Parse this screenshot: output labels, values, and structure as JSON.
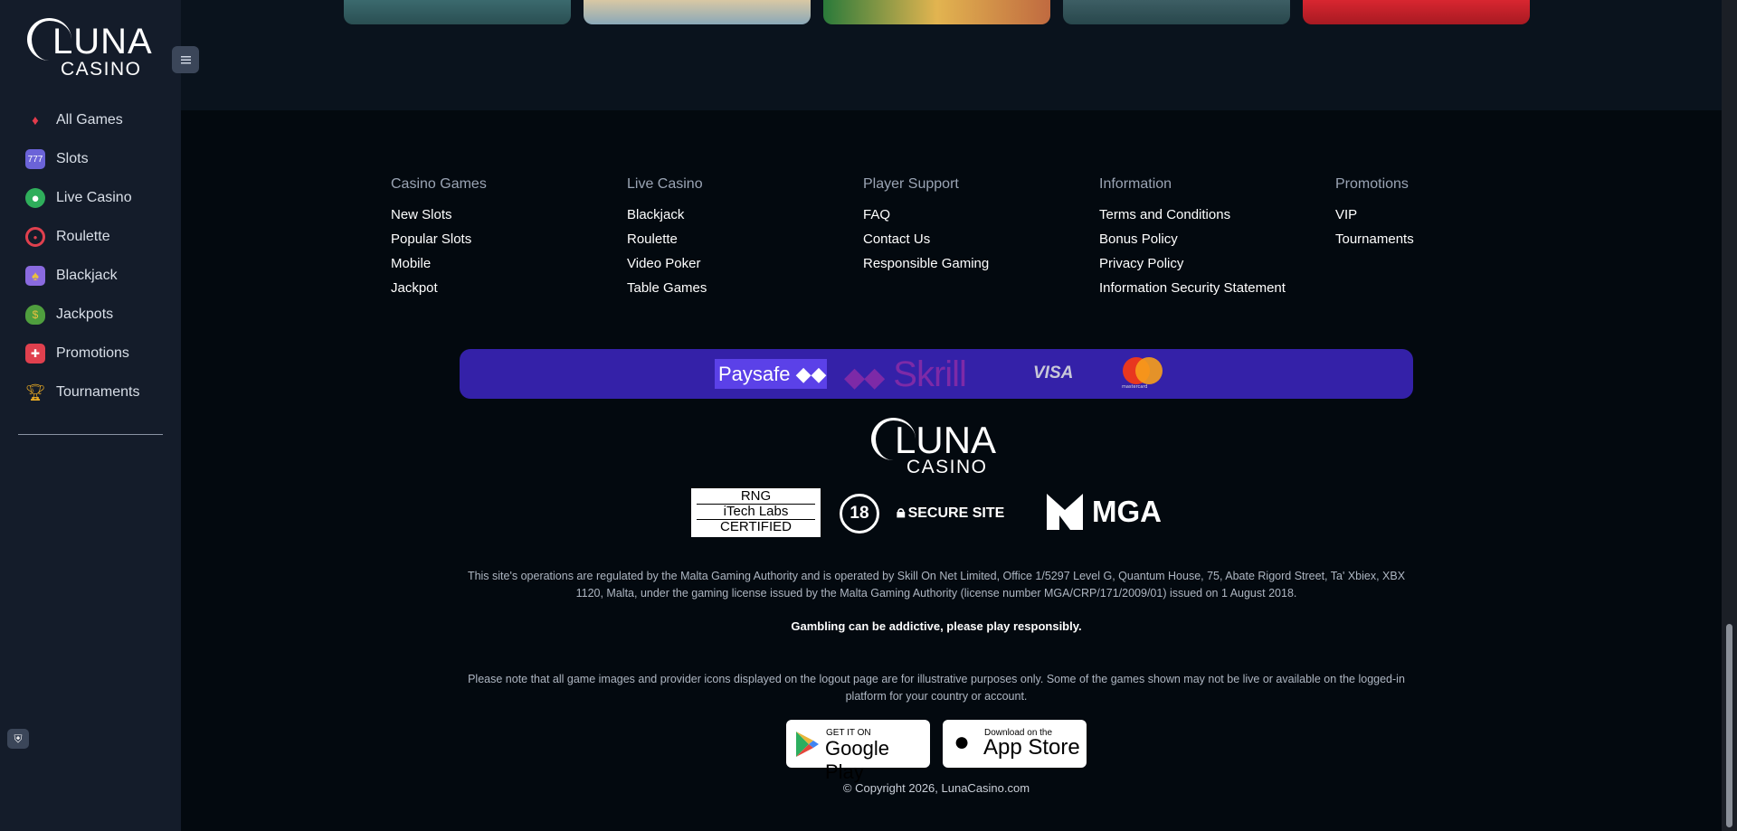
{
  "sidebar": {
    "logo": {
      "line1": "LUNA",
      "line2": "CASINO"
    },
    "items": [
      {
        "label": "All Games",
        "icon": "cards-suits-icon",
        "color": "#e23b4b"
      },
      {
        "label": "Slots",
        "icon": "slot-machine-icon",
        "color": "#6b63d8"
      },
      {
        "label": "Live Casino",
        "icon": "live-dealer-icon",
        "color": "#2fae5b"
      },
      {
        "label": "Roulette",
        "icon": "roulette-icon",
        "color": "#e0404e"
      },
      {
        "label": "Blackjack",
        "icon": "playing-cards-icon",
        "color": "#8a6adf"
      },
      {
        "label": "Jackpots",
        "icon": "money-bag-icon",
        "color": "#4f9e3e"
      },
      {
        "label": "Promotions",
        "icon": "gift-icon",
        "color": "#e0404e"
      },
      {
        "label": "Tournaments",
        "icon": "trophy-icon",
        "color": "#e8a923"
      }
    ]
  },
  "footer": {
    "columns": [
      {
        "title": "Casino Games",
        "links": [
          "New Slots",
          "Popular Slots",
          "Mobile",
          "Jackpot"
        ]
      },
      {
        "title": "Live Casino",
        "links": [
          "Blackjack",
          "Roulette",
          "Video Poker",
          "Table Games"
        ]
      },
      {
        "title": "Player Support",
        "links": [
          "FAQ",
          "Contact Us",
          "Responsible Gaming"
        ]
      },
      {
        "title": "Information",
        "links": [
          "Terms and Conditions",
          "Bonus Policy",
          "Privacy Policy",
          "Information Security Statement"
        ]
      },
      {
        "title": "Promotions",
        "links": [
          "VIP",
          "Tournaments"
        ]
      }
    ],
    "payments": {
      "paysafe": "Paysafe",
      "skrill": "Skrill",
      "visa": "VISA",
      "mastercard": "mastercard"
    },
    "logo": {
      "line1": "LUNA",
      "line2": "CASINO"
    },
    "badges": {
      "rng": [
        "RNG",
        "iTech Labs",
        "CERTIFIED"
      ],
      "age": "18",
      "secure": "SECURE SITE",
      "mga": "MGA"
    },
    "legal": "This site's operations are regulated by the Malta Gaming Authority and is operated by Skill On Net Limited, Office 1/5297 Level G, Quantum House, 75, Abate Rigord Street, Ta' Xbiex, XBX 1120, Malta, under the gaming license issued by the Malta Gaming Authority (license number MGA/CRP/171/2009/01) issued on 1 August 2018.",
    "warning": "Gambling can be addictive, please play responsibly.",
    "note": "Please note that all game images and provider icons displayed on the logout page are for illustrative purposes only. Some of the games shown may not be live or available on the logged-in platform for your country or account.",
    "google_play": {
      "small": "GET IT ON",
      "big": "Google Play"
    },
    "app_store": {
      "small": "Download on the",
      "big": "App Store"
    },
    "copyright": "© Copyright 2026, LunaCasino.com"
  }
}
